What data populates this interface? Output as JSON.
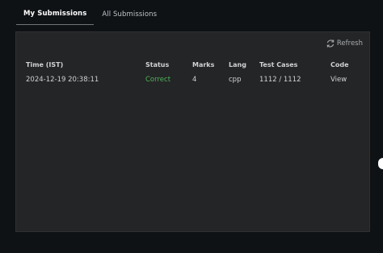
{
  "tabs": [
    {
      "label": "My Submissions",
      "active": true
    },
    {
      "label": "All Submissions",
      "active": false
    }
  ],
  "refresh": {
    "label": "Refresh",
    "icon": "refresh-icon"
  },
  "table": {
    "headers": [
      "Time (IST)",
      "Status",
      "Marks",
      "Lang",
      "Test Cases",
      "Code"
    ],
    "rows": [
      {
        "time": "2024-12-19 20:38:11",
        "status": "Correct",
        "marks": "4",
        "lang": "cpp",
        "test_cases": "1112 / 1112",
        "code": "View"
      }
    ]
  },
  "colors": {
    "background": "#0f1215",
    "panel": "#242526",
    "status_correct": "#4fb35c"
  }
}
